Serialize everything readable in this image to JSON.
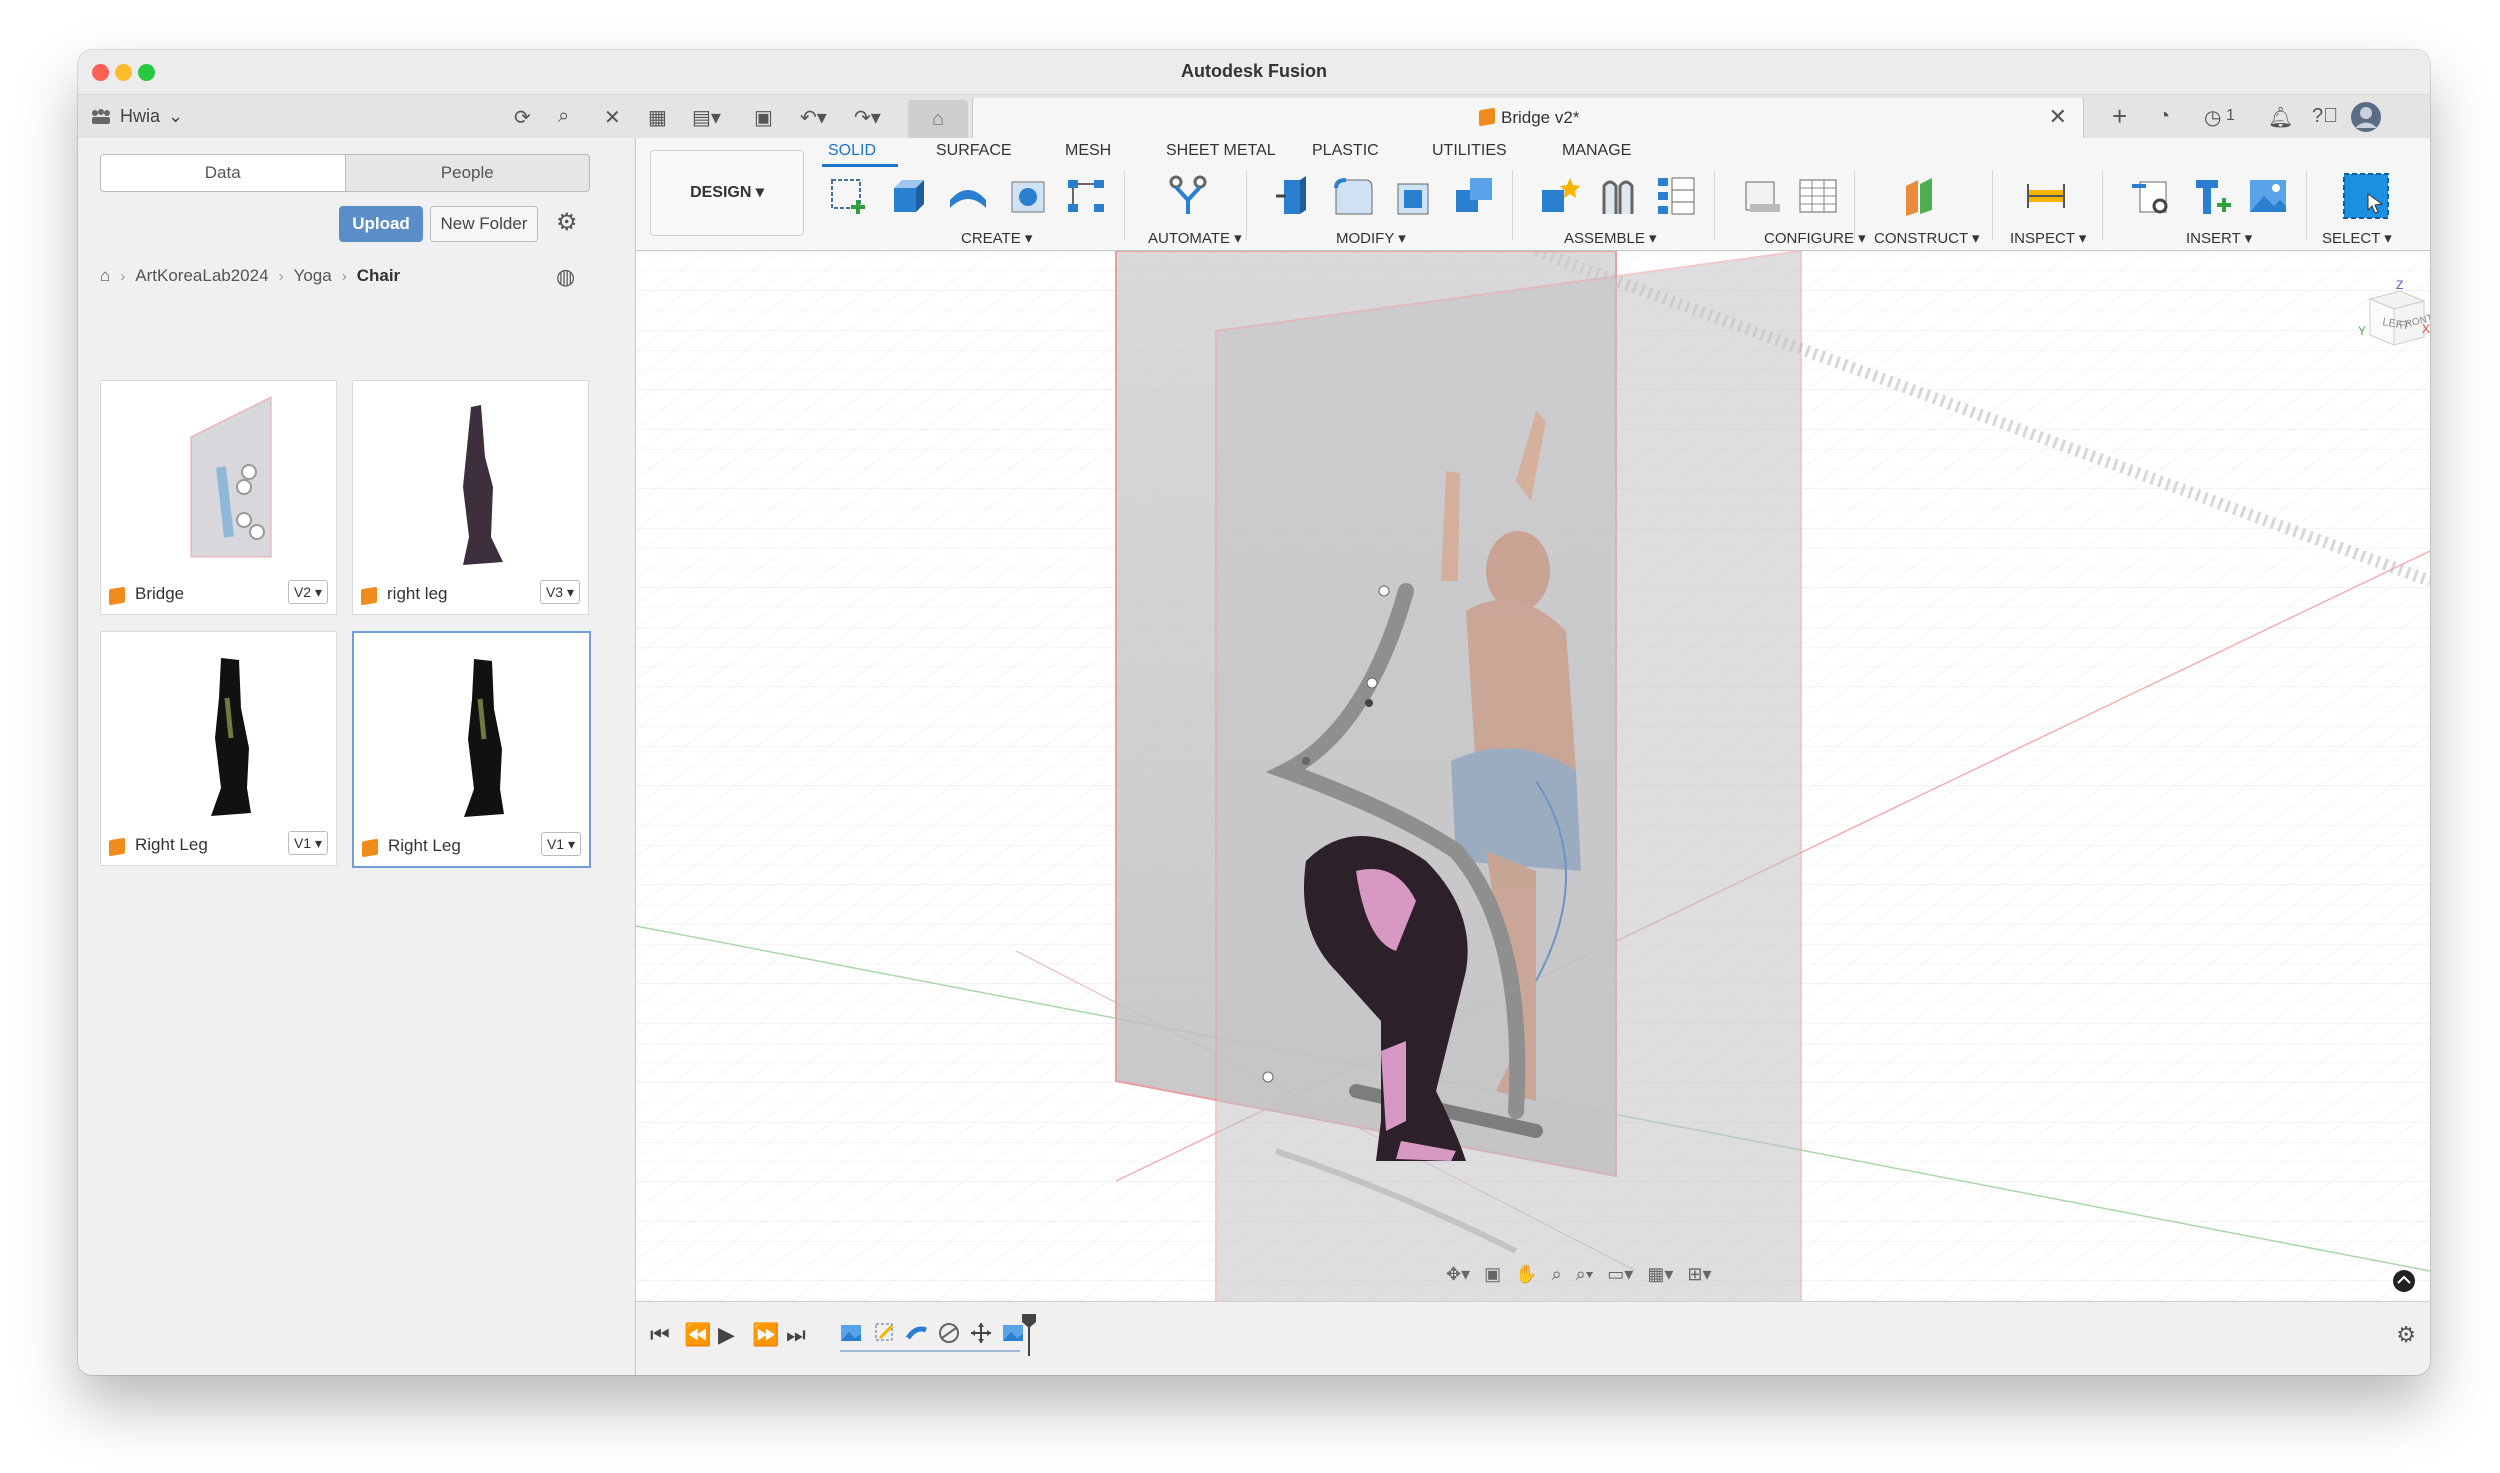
{
  "window": {
    "title": "Autodesk Fusion"
  },
  "topbar": {
    "team": "Hwia",
    "notification_count": "1"
  },
  "document_tab": {
    "name": "Bridge v2*"
  },
  "data_panel": {
    "tabs": [
      "Data",
      "People"
    ],
    "upload_label": "Upload",
    "new_folder_label": "New Folder",
    "breadcrumb": [
      "ArtKoreaLab2024",
      "Yoga",
      "Chair"
    ],
    "files": [
      {
        "name": "Bridge",
        "version": "V2"
      },
      {
        "name": "right leg",
        "version": "V3"
      },
      {
        "name": "Right Leg",
        "version": "V1"
      },
      {
        "name": "Right Leg",
        "version": "V1"
      }
    ]
  },
  "toolbar": {
    "workspace": "DESIGN",
    "tabs": [
      "SOLID",
      "SURFACE",
      "MESH",
      "SHEET METAL",
      "PLASTIC",
      "UTILITIES",
      "MANAGE"
    ],
    "active_tab": "SOLID",
    "groups": [
      "CREATE",
      "AUTOMATE",
      "MODIFY",
      "ASSEMBLE",
      "CONFIGURE",
      "CONSTRUCT",
      "INSPECT",
      "INSERT",
      "SELECT"
    ]
  },
  "viewcube": {
    "faces": [
      "LEFT",
      "FRONT"
    ],
    "axes": [
      "Z",
      "Y",
      "X"
    ]
  },
  "colors": {
    "accent": "#1b74c8",
    "upload": "#5b8ec9",
    "component": "#f08c1e"
  }
}
